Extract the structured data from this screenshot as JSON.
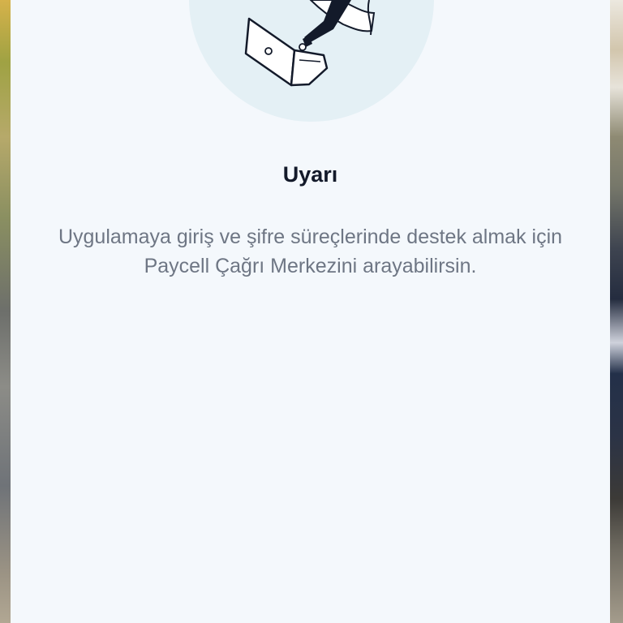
{
  "dialog": {
    "title": "Uyarı",
    "message": "Uygulamaya giriş ve şifre süreçlerinde destek almak için Paycell Çağrı Merkezini arayabilirsin.",
    "illustration_icon": "laptop-typing-illustration"
  },
  "colors": {
    "sheet_background": "#f4f8fc",
    "illustration_circle": "#e4f0f5",
    "title": "#131a2a",
    "message": "#6e7684"
  }
}
